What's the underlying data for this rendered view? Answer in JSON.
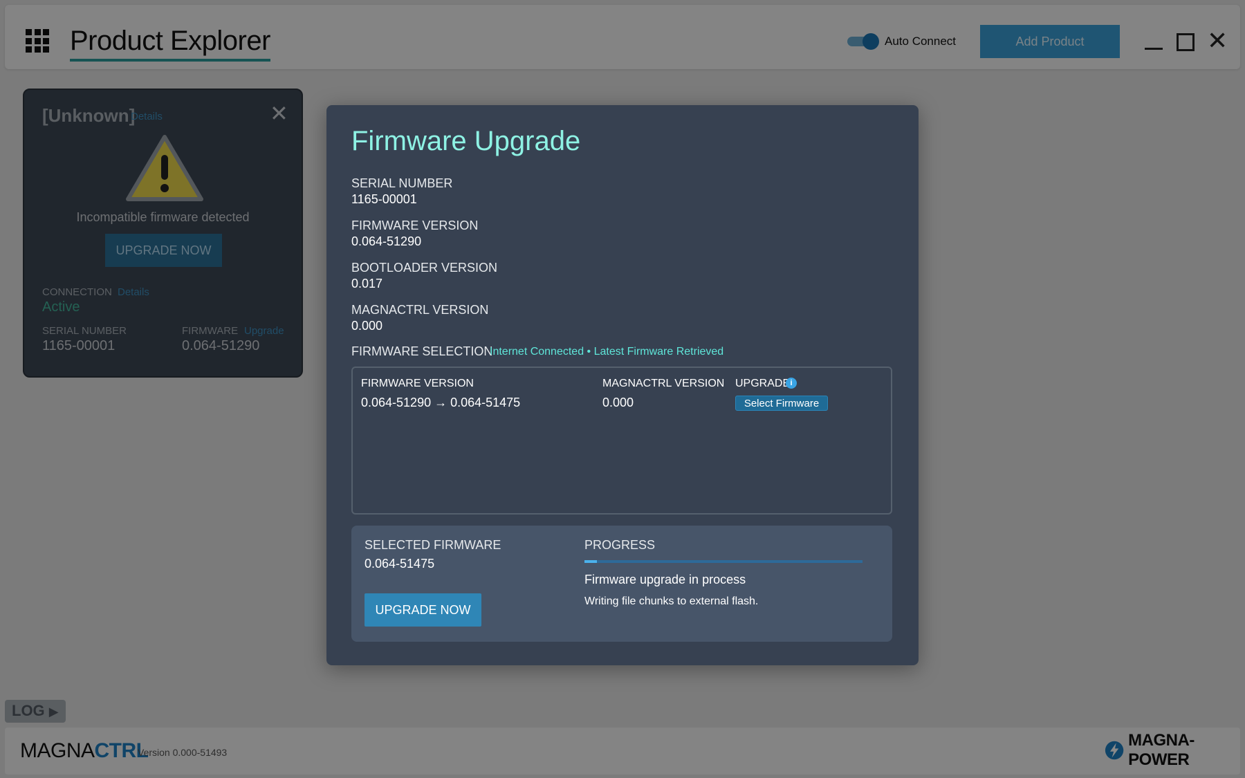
{
  "header": {
    "title": "Product Explorer",
    "auto_connect_label": "Auto Connect",
    "auto_connect_enabled": true,
    "add_product_label": "Add Product"
  },
  "device_card": {
    "title": "[Unknown]",
    "title_details_link": "Details",
    "warning_text": "Incompatible firmware detected",
    "upgrade_button": "UPGRADE NOW",
    "connection_label": "CONNECTION",
    "connection_details_link": "Details",
    "connection_status": "Active",
    "serial_label": "SERIAL NUMBER",
    "serial_value": "1165-00001",
    "firmware_label": "FIRMWARE",
    "firmware_upgrade_link": "Upgrade",
    "firmware_value": "0.064-51290"
  },
  "log_tab": {
    "label": "LOG"
  },
  "footer": {
    "brand_part1": "MAGNA",
    "brand_part2": "CTRL",
    "version": "Version 0.000-51493",
    "company": "MAGNA-POWER"
  },
  "modal": {
    "title": "Firmware Upgrade",
    "fields": [
      {
        "label": "SERIAL NUMBER",
        "value": "1165-00001"
      },
      {
        "label": "FIRMWARE VERSION",
        "value": "0.064-51290"
      },
      {
        "label": "BOOTLOADER VERSION",
        "value": "0.017"
      },
      {
        "label": "MAGNACTRL VERSION",
        "value": "0.000"
      }
    ],
    "selection_label": "FIRMWARE SELECTION",
    "internet_status": "Internet Connected • Latest Firmware Retrieved",
    "table": {
      "headers": [
        "FIRMWARE VERSION",
        "MAGNACTRL VERSION",
        "UPGRADE"
      ],
      "rows": [
        {
          "firmware": "0.064-51290 → 0.064-51475",
          "magnactrl": "0.000",
          "action": "Select Firmware"
        }
      ]
    },
    "selected_firmware_label": "SELECTED FIRMWARE",
    "selected_firmware_value": "0.064-51475",
    "upgrade_button": "UPGRADE NOW",
    "progress_label": "PROGRESS",
    "progress_fraction": 0.045,
    "progress_status": "Firmware upgrade in process",
    "progress_detail": "Writing file chunks to external flash."
  },
  "colors": {
    "accent_teal": "#8ef2e4",
    "status_cyan": "#5fe6d9",
    "primary_blue": "#2f86b6",
    "active_green": "#43b39a",
    "modal_bg": "#374151"
  }
}
